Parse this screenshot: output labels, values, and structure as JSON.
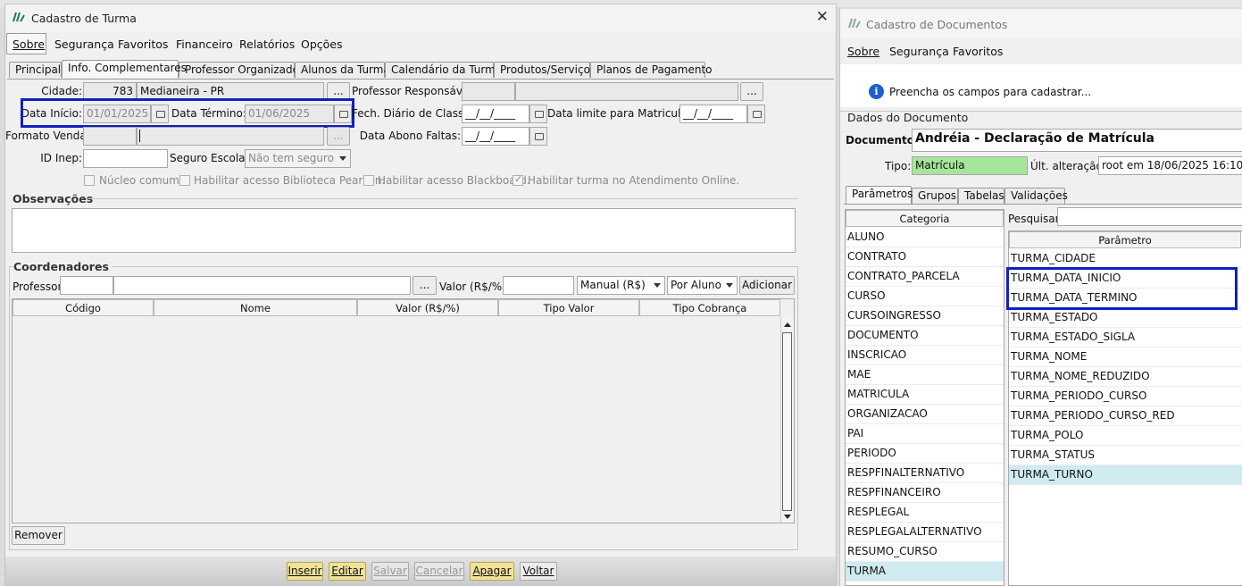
{
  "turma_window": {
    "title": "Cadastro de Turma",
    "menu": [
      "Sobre",
      "Segurança",
      "Favoritos",
      "Financeiro",
      "Relatórios",
      "Opções"
    ],
    "tabs": [
      "Principal",
      "Info. Complementares",
      "Professor Organizador",
      "Alunos da Turma",
      "Calendário da Turma",
      "Produtos/Serviços",
      "Planos de Pagamento"
    ],
    "active_tab": "Info. Complementares",
    "form": {
      "cidade_label": "Cidade:",
      "cidade_code": "783",
      "cidade_name": "Medianeira - PR",
      "professor_responsavel_label": "Professor Responsável:",
      "data_inicio_label": "Data Início:",
      "data_inicio_value": "01/01/2025",
      "data_termino_label": "Data Término:",
      "data_termino_value": "01/06/2025",
      "fech_diario_label": "Fech. Diário de Classe:",
      "fech_diario_value": "__/__/____",
      "data_limite_label": "Data limite para Matriculas:",
      "data_limite_value": "__/__/____",
      "formato_venda_label": "Formato Venda:",
      "data_abono_label": "Data Abono Faltas:",
      "data_abono_value": "__/__/____",
      "id_inep_label": "ID Inep:",
      "seguro_label": "Seguro Escolar:",
      "seguro_value": "Não tem seguro",
      "ellipsis": "...",
      "checkboxes": [
        {
          "label": "Núcleo comum.",
          "checked": false
        },
        {
          "label": "Habilitar acesso Biblioteca Pearson.",
          "checked": false
        },
        {
          "label": "Habilitar acesso Blackboard.",
          "checked": false
        },
        {
          "label": "Habilitar turma no Atendimento Online.",
          "checked": true
        }
      ]
    },
    "observacoes_title": "Observações",
    "coordenadores": {
      "title": "Coordenadores",
      "professor_label": "Professor:",
      "valor_label": "Valor (R$/%):",
      "tipo_valor_value": "Manual (R$)",
      "tipo_cobranca_value": "Por Aluno",
      "adicionar_label": "Adicionar",
      "columns": [
        "Código",
        "Nome",
        "Valor (R$/%)",
        "Tipo Valor",
        "Tipo Cobrança"
      ],
      "remover_label": "Remover"
    },
    "bottom_buttons": [
      {
        "label": "Inserir",
        "enabled": true
      },
      {
        "label": "Editar",
        "enabled": true
      },
      {
        "label": "Salvar",
        "enabled": false
      },
      {
        "label": "Cancelar",
        "enabled": false
      },
      {
        "label": "Apagar",
        "enabled": true
      },
      {
        "label": "Voltar",
        "enabled": true
      }
    ]
  },
  "documentos_window": {
    "title": "Cadastro de Documentos",
    "menu": [
      "Sobre",
      "Segurança",
      "Favoritos"
    ],
    "info_text": "Preencha os campos para cadastrar...",
    "dados_title": "Dados do Documento",
    "documento_label": "Documento:",
    "documento_value": "Andréia - Declaração de Matrícula",
    "tipo_label": "Tipo:",
    "tipo_value": "Matrícula",
    "ult_alteracao_label": "Últ. alteração:",
    "ult_alteracao_value": "root em 18/06/2025 16:10",
    "tabs": [
      "Parâmetros",
      "Grupos",
      "Tabelas",
      "Validações"
    ],
    "categoria_header": "Categoria",
    "categorias": [
      "ALUNO",
      "CONTRATO",
      "CONTRATO_PARCELA",
      "CURSO",
      "CURSOINGRESSO",
      "DOCUMENTO",
      "INSCRICAO",
      "MAE",
      "MATRICULA",
      "ORGANIZACAO",
      "PAI",
      "PERIODO",
      "RESPFINALTERNATIVO",
      "RESPFINANCEIRO",
      "RESPLEGAL",
      "RESPLEGALALTERNATIVO",
      "RESUMO_CURSO",
      "TURMA"
    ],
    "selected_categoria": "TURMA",
    "pesquisar_label": "Pesquisar:",
    "parametro_header": "Parâmetro",
    "parametros": [
      "TURMA_CIDADE",
      "TURMA_DATA_INICIO",
      "TURMA_DATA_TERMINO",
      "TURMA_ESTADO",
      "TURMA_ESTADO_SIGLA",
      "TURMA_NOME",
      "TURMA_NOME_REDUZIDO",
      "TURMA_PERIODO_CURSO",
      "TURMA_PERIODO_CURSO_RED",
      "TURMA_POLO",
      "TURMA_STATUS",
      "TURMA_TURNO"
    ],
    "selected_parametro": "TURMA_TURNO"
  },
  "colors": {
    "highlight_border": "#1020c0",
    "selection": "#cfeaf0",
    "tipo_green": "#a6e69a",
    "action_button": "#f1e29a"
  }
}
